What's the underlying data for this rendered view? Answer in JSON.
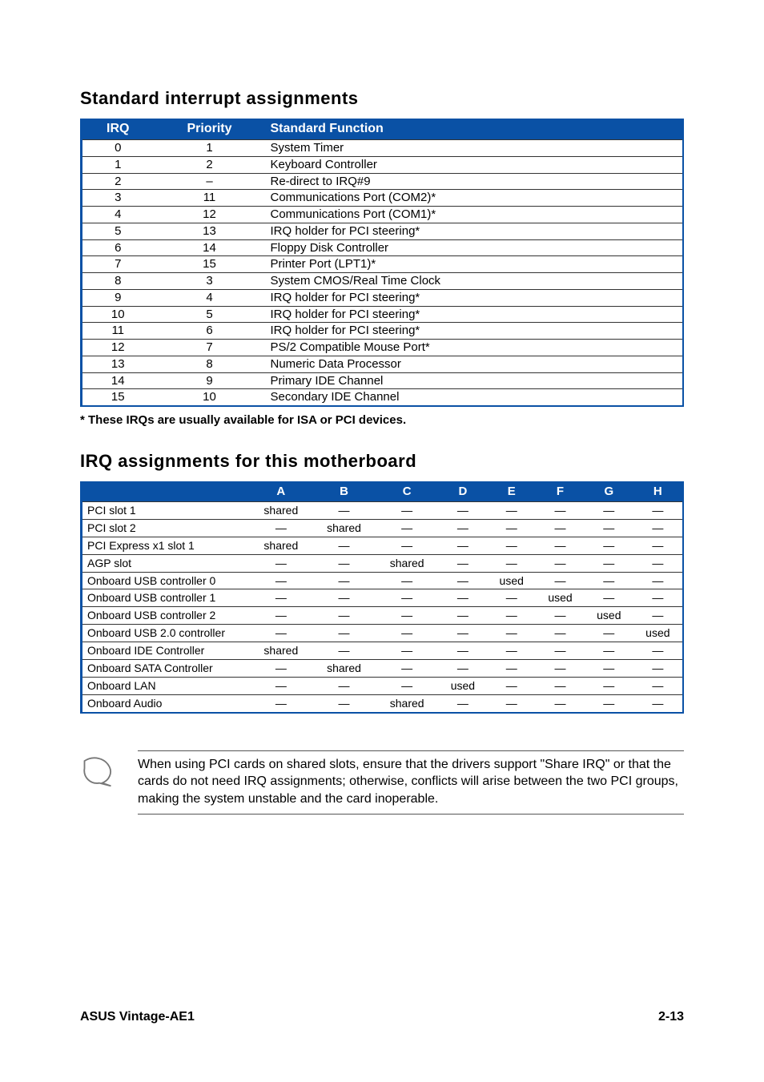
{
  "headings": {
    "h1": "Standard interrupt assignments",
    "h2": "IRQ assignments for this motherboard"
  },
  "table1": {
    "headers": {
      "irq": "IRQ",
      "priority": "Priority",
      "func": "Standard Function"
    },
    "rows": [
      {
        "irq": "0",
        "priority": "1",
        "func": "System Timer"
      },
      {
        "irq": "1",
        "priority": "2",
        "func": "Keyboard Controller"
      },
      {
        "irq": "2",
        "priority": "–",
        "func": "Re-direct to IRQ#9"
      },
      {
        "irq": "3",
        "priority": "11",
        "func": "Communications Port (COM2)*"
      },
      {
        "irq": "4",
        "priority": "12",
        "func": "Communications Port (COM1)*"
      },
      {
        "irq": "5",
        "priority": "13",
        "func": "IRQ holder for PCI steering*"
      },
      {
        "irq": "6",
        "priority": "14",
        "func": "Floppy Disk Controller"
      },
      {
        "irq": "7",
        "priority": "15",
        "func": "Printer Port (LPT1)*"
      },
      {
        "irq": "8",
        "priority": "3",
        "func": "System CMOS/Real Time Clock"
      },
      {
        "irq": "9",
        "priority": "4",
        "func": "IRQ holder for PCI steering*"
      },
      {
        "irq": "10",
        "priority": "5",
        "func": "IRQ holder for PCI steering*"
      },
      {
        "irq": "11",
        "priority": "6",
        "func": "IRQ holder for PCI steering*"
      },
      {
        "irq": "12",
        "priority": "7",
        "func": "PS/2 Compatible Mouse Port*"
      },
      {
        "irq": "13",
        "priority": "8",
        "func": "Numeric Data Processor"
      },
      {
        "irq": "14",
        "priority": "9",
        "func": "Primary IDE Channel"
      },
      {
        "irq": "15",
        "priority": "10",
        "func": "Secondary IDE Channel"
      }
    ],
    "footnote": "* These IRQs are usually available for ISA or PCI devices."
  },
  "table2": {
    "headers": [
      "",
      "A",
      "B",
      "C",
      "D",
      "E",
      "F",
      "G",
      "H"
    ],
    "rows": [
      {
        "label": "PCI slot 1",
        "cells": [
          "shared",
          "—",
          "—",
          "—",
          "—",
          "—",
          "—",
          "—"
        ]
      },
      {
        "label": "PCI slot 2",
        "cells": [
          "—",
          "shared",
          "—",
          "—",
          "—",
          "—",
          "—",
          "—"
        ]
      },
      {
        "label": "PCI Express x1 slot 1",
        "cells": [
          "shared",
          "—",
          "—",
          "—",
          "—",
          "—",
          "—",
          "—"
        ]
      },
      {
        "label": "AGP slot",
        "cells": [
          "—",
          "—",
          "shared",
          "—",
          "—",
          "—",
          "—",
          "—"
        ]
      },
      {
        "label": "Onboard USB controller 0",
        "cells": [
          "—",
          "—",
          "—",
          "—",
          "used",
          "—",
          "—",
          "—"
        ]
      },
      {
        "label": "Onboard USB controller 1",
        "cells": [
          "—",
          "—",
          "—",
          "—",
          "—",
          "used",
          "—",
          "—"
        ]
      },
      {
        "label": "Onboard USB controller 2",
        "cells": [
          "—",
          "—",
          "—",
          "—",
          "—",
          "—",
          "used",
          "—"
        ]
      },
      {
        "label": "Onboard USB 2.0 controller",
        "cells": [
          "—",
          "—",
          "—",
          "—",
          "—",
          "—",
          "—",
          "used"
        ]
      },
      {
        "label": "Onboard IDE Controller",
        "cells": [
          "shared",
          "—",
          "—",
          "—",
          "—",
          "—",
          "—",
          "—"
        ]
      },
      {
        "label": "Onboard SATA Controller",
        "cells": [
          "—",
          "shared",
          "—",
          "—",
          "—",
          "—",
          "—",
          "—"
        ]
      },
      {
        "label": "Onboard LAN",
        "cells": [
          "—",
          "—",
          "—",
          "used",
          "—",
          "—",
          "—",
          "—"
        ]
      },
      {
        "label": "Onboard Audio",
        "cells": [
          "—",
          "—",
          "shared",
          "—",
          "—",
          "—",
          "—",
          "—"
        ]
      }
    ]
  },
  "note": "When using PCI cards on shared slots, ensure that the drivers support \"Share IRQ\" or that the cards do not need IRQ assignments; otherwise, conflicts will arise between the two PCI groups, making the system unstable and the card inoperable.",
  "footer": {
    "left": "ASUS Vintage-AE1",
    "right": "2-13"
  }
}
